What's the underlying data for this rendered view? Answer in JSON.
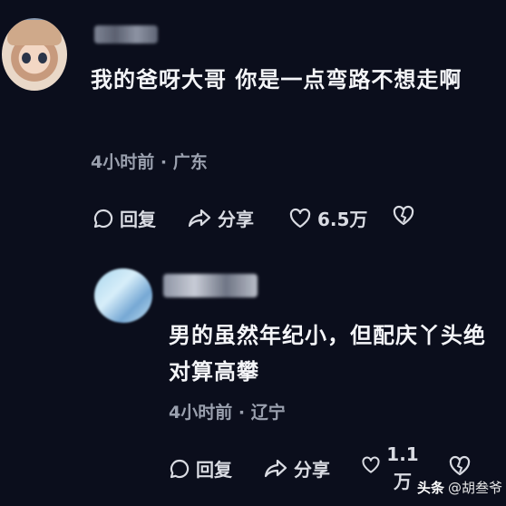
{
  "comments": [
    {
      "text": "我的爸呀大哥 你是一点弯路不想走啊",
      "time": "4小时前",
      "location": "广东",
      "reply_label": "回复",
      "share_label": "分享",
      "likes": "6.5万"
    },
    {
      "text": "男的虽然年纪小，但配庆丫头绝对算高攀",
      "time": "4小时前",
      "location": "辽宁",
      "reply_label": "回复",
      "share_label": "分享",
      "likes": "1.1\n万"
    }
  ],
  "watermark": {
    "brand": "头条",
    "handle": "@胡叁爷"
  },
  "colors": {
    "background": "#0b0e1c",
    "text": "#f4f5f8",
    "muted": "#9aa0ae"
  }
}
